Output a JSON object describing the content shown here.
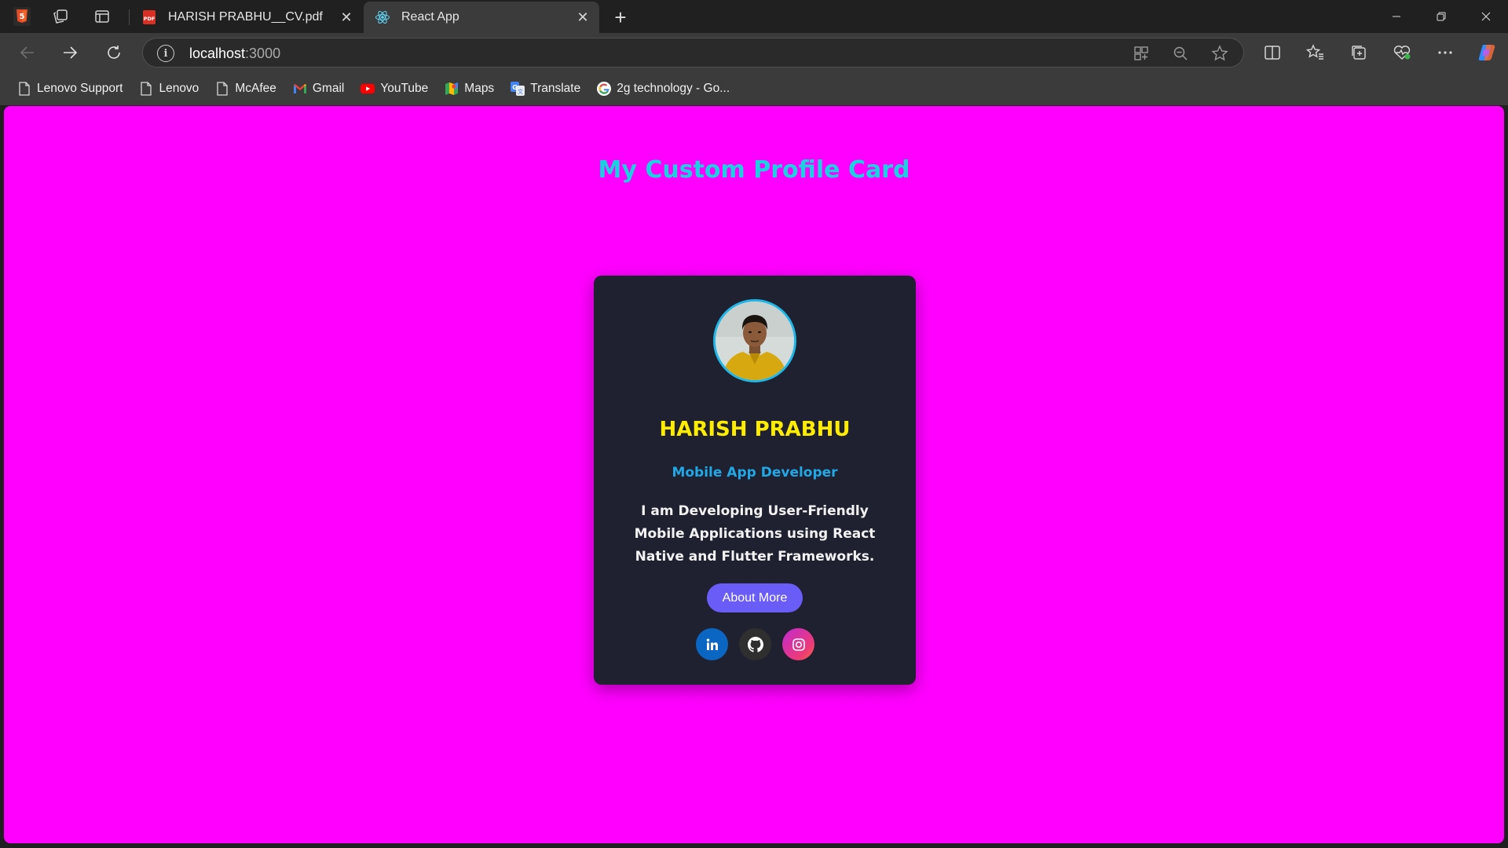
{
  "browser": {
    "tabs": [
      {
        "title": "HARISH PRABHU__CV.pdf",
        "favicon": "pdf-icon",
        "active": false
      },
      {
        "title": "React App",
        "favicon": "react-icon",
        "active": true
      }
    ],
    "address": {
      "host": "localhost",
      "port": ":3000"
    },
    "bookmarks": [
      {
        "label": "Lenovo Support",
        "icon": "page-icon"
      },
      {
        "label": "Lenovo",
        "icon": "page-icon"
      },
      {
        "label": "McAfee",
        "icon": "page-icon"
      },
      {
        "label": "Gmail",
        "icon": "gmail-icon"
      },
      {
        "label": "YouTube",
        "icon": "youtube-icon"
      },
      {
        "label": "Maps",
        "icon": "maps-icon"
      },
      {
        "label": "Translate",
        "icon": "translate-icon"
      },
      {
        "label": "2g technology - Go...",
        "icon": "google-icon"
      }
    ]
  },
  "page": {
    "heading": "My Custom Profile Card",
    "background_color": "#ff00ff",
    "card": {
      "name": "HARISH PRABHU",
      "role": "Mobile App Developer",
      "bio": "I am Developing User-Friendly Mobile Applications using React Native and Flutter Frameworks.",
      "button_label": "About More",
      "socials": [
        "linkedin-icon",
        "github-icon",
        "instagram-icon"
      ]
    }
  },
  "colors": {
    "heading": "#1ad1e0",
    "name": "#ffec00",
    "role": "#21a8e6",
    "button": "#6a5cf6",
    "card_bg": "#1f2030"
  }
}
